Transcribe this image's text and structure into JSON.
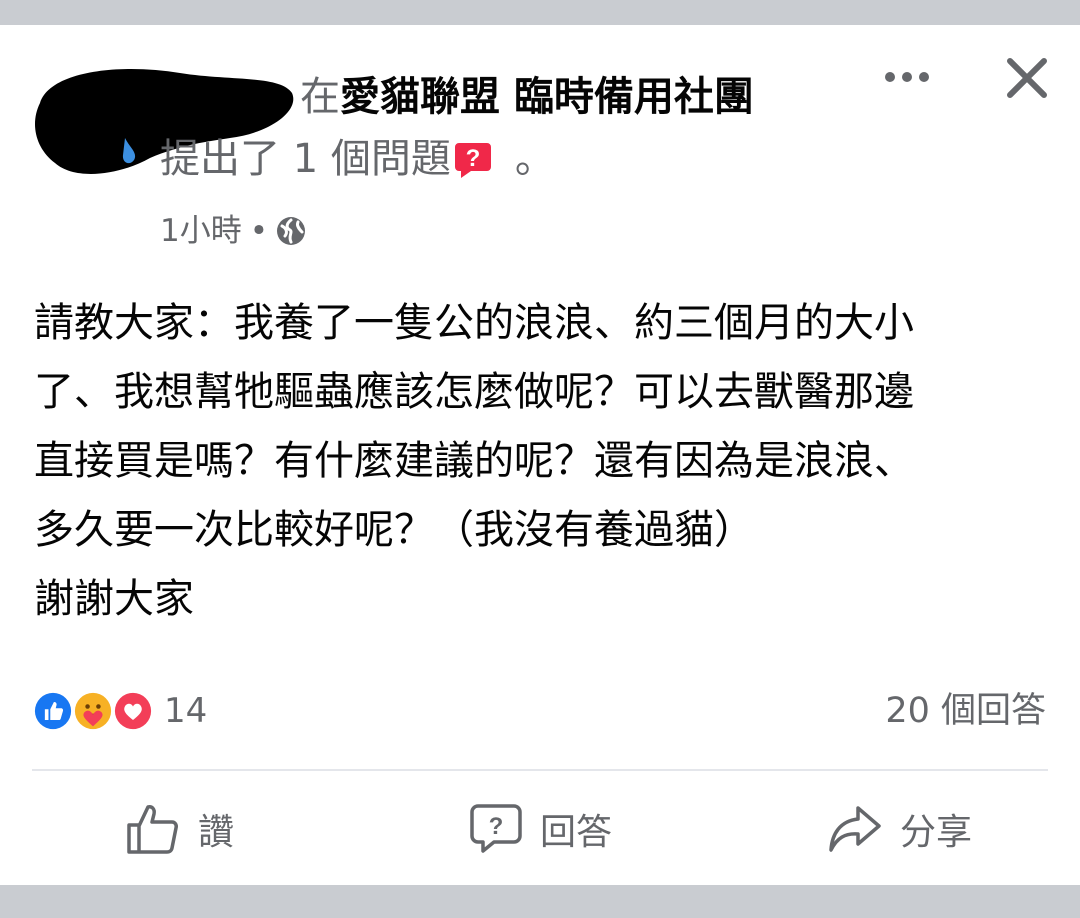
{
  "header": {
    "preposition": "在",
    "group_name": "愛貓聯盟 臨時備用社團",
    "action_text": "提出了 1 個問題",
    "action_suffix": "。",
    "time": "1小時",
    "separator": "•",
    "privacy_icon": "globe-icon",
    "more_icon": "more-icon",
    "close_icon": "close-icon"
  },
  "post": {
    "lines": [
      "請教大家：我養了一隻公的浪浪、約三個月的大小",
      "了、我想幫牠驅蟲應該怎麼做呢？可以去獸醫那邊",
      "直接買是嗎？有什麼建議的呢？還有因為是浪浪、",
      "多久要一次比較好呢？（我沒有養過貓）",
      "謝謝大家"
    ]
  },
  "engagement": {
    "reactions": [
      "like-reaction-icon",
      "care-reaction-icon",
      "love-reaction-icon"
    ],
    "reaction_count": "14",
    "answers_count": "20 個回答"
  },
  "actions": {
    "like_label": "讚",
    "answer_label": "回答",
    "share_label": "分享"
  },
  "colors": {
    "primary_text": "#050505",
    "secondary_text": "#65676b",
    "like_blue": "#1877f2",
    "love_red": "#f33e58",
    "question_badge": "#f02849",
    "background": "#c9ccd1"
  }
}
